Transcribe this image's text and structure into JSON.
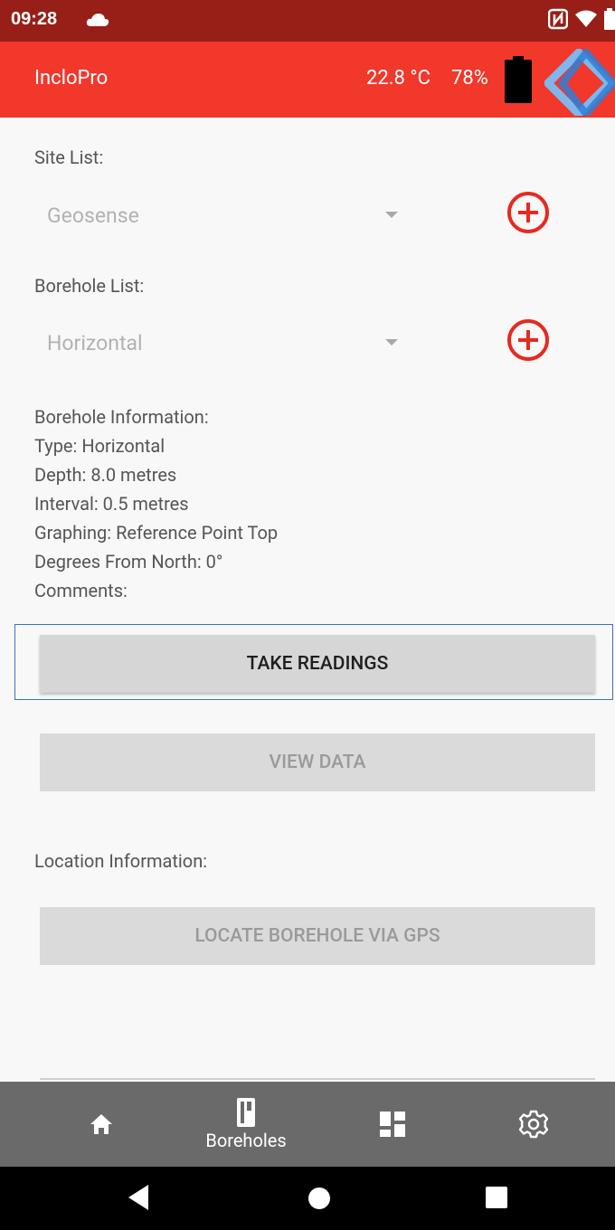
{
  "status": {
    "time": "09:28"
  },
  "appbar": {
    "title": "IncloPro",
    "temperature": "22.8 °C",
    "battery": "78%"
  },
  "site": {
    "label": "Site List:",
    "selected": "Geosense"
  },
  "borehole": {
    "label": "Borehole List:",
    "selected": "Horizontal"
  },
  "info": {
    "heading": "Borehole Information:",
    "type": "Type: Horizontal",
    "depth": "Depth: 8.0 metres",
    "interval": "Interval: 0.5 metres",
    "graphing": "Graphing: Reference Point Top",
    "degrees": "Degrees From North: 0°",
    "comments": "Comments:"
  },
  "buttons": {
    "take_readings": "TAKE READINGS",
    "view_data": "VIEW DATA",
    "locate_gps": "LOCATE BOREHOLE VIA GPS"
  },
  "location": {
    "label": "Location Information:"
  },
  "nav": {
    "items": [
      {
        "icon": "home-icon",
        "label": ""
      },
      {
        "icon": "borehole-icon",
        "label": "Boreholes"
      },
      {
        "icon": "dashboard-icon",
        "label": ""
      },
      {
        "icon": "gear-icon",
        "label": ""
      }
    ]
  },
  "colors": {
    "statusbar": "#981f17",
    "appbar": "#f2372b",
    "add_icon": "#e8291f",
    "bottomnav": "#6a6a6a"
  }
}
